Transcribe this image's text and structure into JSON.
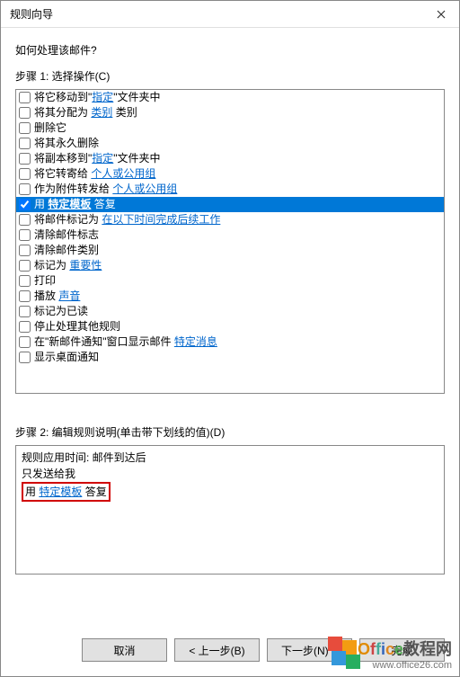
{
  "window": {
    "title": "规则向导"
  },
  "question": "如何处理该邮件?",
  "step1": {
    "label": "步骤 1: 选择操作(C)",
    "actions": [
      {
        "checked": false,
        "prefix": "将它移动到\"",
        "link": "指定",
        "suffix": "\"文件夹中"
      },
      {
        "checked": false,
        "prefix": "将其分配为 ",
        "link": "类别",
        "suffix": " 类别"
      },
      {
        "checked": false,
        "prefix": "删除它",
        "link": "",
        "suffix": ""
      },
      {
        "checked": false,
        "prefix": "将其永久删除",
        "link": "",
        "suffix": ""
      },
      {
        "checked": false,
        "prefix": "将副本移到\"",
        "link": "指定",
        "suffix": "\"文件夹中"
      },
      {
        "checked": false,
        "prefix": "将它转寄给 ",
        "link": "个人或公用组",
        "suffix": ""
      },
      {
        "checked": false,
        "prefix": "作为附件转发给 ",
        "link": "个人或公用组",
        "suffix": ""
      },
      {
        "checked": true,
        "prefix": "用 ",
        "link": "特定模板",
        "suffix": " 答复",
        "selected": true,
        "bold": true
      },
      {
        "checked": false,
        "prefix": "将邮件标记为 ",
        "link": "在以下时间完成后续工作",
        "suffix": ""
      },
      {
        "checked": false,
        "prefix": "清除邮件标志",
        "link": "",
        "suffix": ""
      },
      {
        "checked": false,
        "prefix": "清除邮件类别",
        "link": "",
        "suffix": ""
      },
      {
        "checked": false,
        "prefix": "标记为 ",
        "link": "重要性",
        "suffix": ""
      },
      {
        "checked": false,
        "prefix": "打印",
        "link": "",
        "suffix": ""
      },
      {
        "checked": false,
        "prefix": "播放 ",
        "link": "声音",
        "suffix": ""
      },
      {
        "checked": false,
        "prefix": "标记为已读",
        "link": "",
        "suffix": ""
      },
      {
        "checked": false,
        "prefix": "停止处理其他规则",
        "link": "",
        "suffix": ""
      },
      {
        "checked": false,
        "prefix": "在\"新邮件通知\"窗口显示邮件 ",
        "link": "特定消息",
        "suffix": ""
      },
      {
        "checked": false,
        "prefix": "显示桌面通知",
        "link": "",
        "suffix": ""
      }
    ]
  },
  "step2": {
    "label": "步骤 2: 编辑规则说明(单击带下划线的值)(D)",
    "line1": "规则应用时间: 邮件到达后",
    "line2": "只发送给我",
    "line3_prefix": "用 ",
    "line3_link": "特定模板",
    "line3_suffix": " 答复"
  },
  "buttons": {
    "cancel": "取消",
    "back": "< 上一步(B)",
    "next": "下一步(N) >",
    "finish": "完成"
  },
  "watermark": {
    "text": "Office教程网",
    "url": "www.office26.com"
  }
}
